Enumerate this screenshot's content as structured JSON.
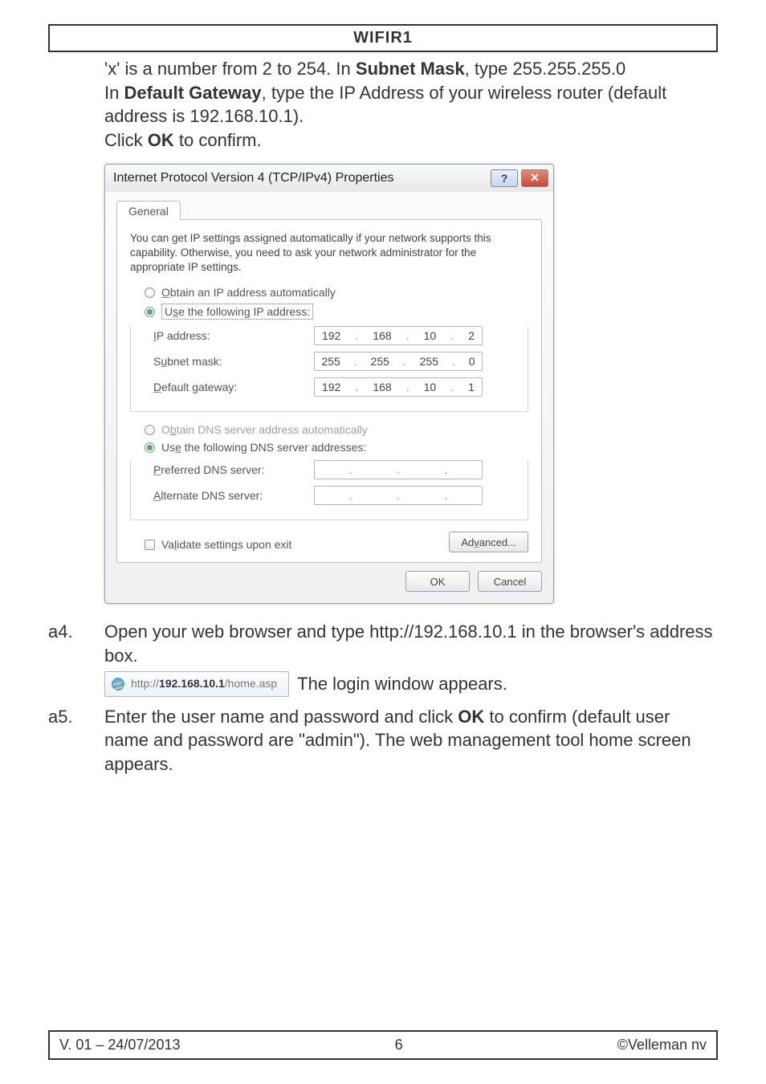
{
  "header": {
    "title": "WIFIR1"
  },
  "intro": {
    "line1a": "'x' is a number from 2 to 254. In ",
    "line1b": "Subnet Mask",
    "line1c": ", type 255.255.255.0",
    "line2a": "In ",
    "line2b": "Default Gateway",
    "line2c": ", type the IP Address of your wireless router (default address is 192.168.10.1).",
    "line3a": "Click ",
    "line3b": "OK",
    "line3c": " to confirm."
  },
  "dialog": {
    "title": "Internet Protocol Version 4 (TCP/IPv4) Properties",
    "help_glyph": "?",
    "close_glyph": "✕",
    "tab": "General",
    "description": "You can get IP settings assigned automatically if your network supports this capability. Otherwise, you need to ask your network administrator for the appropriate IP settings.",
    "radio_auto_ip": "Obtain an IP address automatically",
    "radio_manual_ip": "Use the following IP address:",
    "ip_label": "IP address:",
    "ip_value": {
      "a": "192",
      "b": "168",
      "c": "10",
      "d": "2"
    },
    "subnet_label": "Subnet mask:",
    "subnet_value": {
      "a": "255",
      "b": "255",
      "c": "255",
      "d": "0"
    },
    "gateway_label": "Default gateway:",
    "gateway_value": {
      "a": "192",
      "b": "168",
      "c": "10",
      "d": "1"
    },
    "radio_auto_dns": "Obtain DNS server address automatically",
    "radio_manual_dns": "Use the following DNS server addresses:",
    "pref_dns_label": "Preferred DNS server:",
    "alt_dns_label": "Alternate DNS server:",
    "validate_label": "Validate settings upon exit",
    "advanced_btn": "Advanced...",
    "ok_btn": "OK",
    "cancel_btn": "Cancel"
  },
  "steps": {
    "a4": {
      "num": "a4.",
      "text": "Open your web browser and type http://192.168.10.1 in the browser's address box.",
      "addr_prefix": "http://",
      "addr_bold": "192.168.10.1",
      "addr_rest": "/home.asp",
      "appears": "The login window appears."
    },
    "a5": {
      "num": "a5.",
      "text_a": "Enter the user name and password and click ",
      "text_b": "OK",
      "text_c": " to confirm (default user name and password are \"admin\"). The web management tool home screen appears."
    }
  },
  "footer": {
    "left": "V. 01 – 24/07/2013",
    "center": "6",
    "right": "©Velleman nv"
  }
}
